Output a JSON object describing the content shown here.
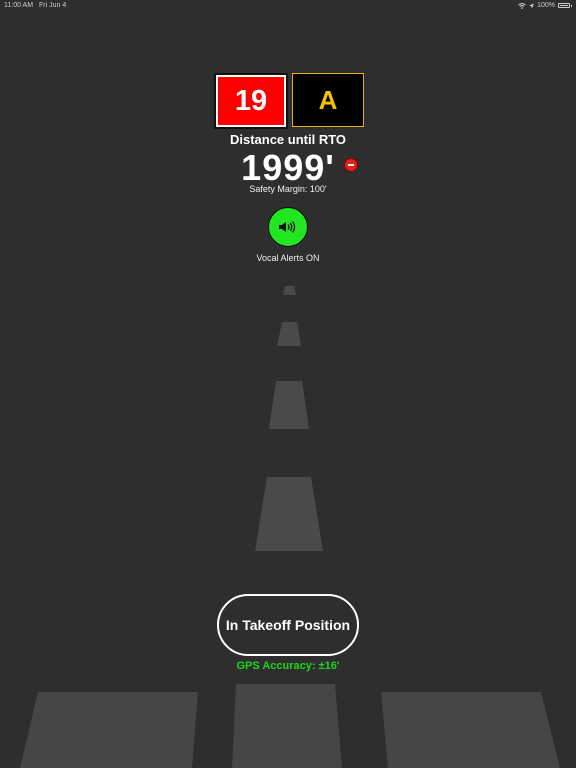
{
  "status_bar": {
    "time": "11:00 AM",
    "date": "Fri Jun 4",
    "battery": "100%",
    "icons": [
      "wifi-icon",
      "location-arrow-icon",
      "battery-icon"
    ]
  },
  "signs": {
    "runway_label": "19",
    "taxiway_label": "A",
    "runway_color": "#ff0000",
    "taxiway_text_color": "#f5c200"
  },
  "distance": {
    "label": "Distance until RTO",
    "value": "1999'",
    "safety_margin": "Safety Margin: 100'"
  },
  "vocal_alerts": {
    "icon": "speaker-icon",
    "label": "Vocal Alerts ON",
    "color": "#22e622"
  },
  "takeoff_button": {
    "label": "In Takeoff Position"
  },
  "gps": {
    "accuracy": "GPS Accuracy: ±16'",
    "color": "#1bd61b"
  }
}
